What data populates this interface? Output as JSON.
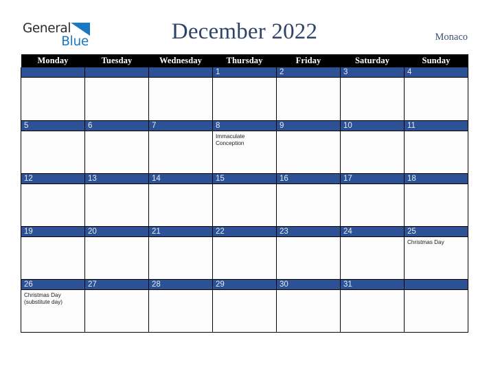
{
  "brand": {
    "name_part1": "General",
    "name_part2": "Blue",
    "triangle_icon": "blue-triangle-icon",
    "color_dark": "#2b2b2b",
    "color_blue": "#1878c4"
  },
  "header": {
    "title": "December 2022",
    "region": "Monaco",
    "title_color": "#2e4369"
  },
  "calendar": {
    "accent_color": "#2c5195",
    "header_bg": "#000000",
    "weekday_headers": [
      "Monday",
      "Tuesday",
      "Wednesday",
      "Thursday",
      "Friday",
      "Saturday",
      "Sunday"
    ],
    "weeks": [
      [
        {
          "day": "",
          "event": ""
        },
        {
          "day": "",
          "event": ""
        },
        {
          "day": "",
          "event": ""
        },
        {
          "day": "1",
          "event": ""
        },
        {
          "day": "2",
          "event": ""
        },
        {
          "day": "3",
          "event": ""
        },
        {
          "day": "4",
          "event": ""
        }
      ],
      [
        {
          "day": "5",
          "event": ""
        },
        {
          "day": "6",
          "event": ""
        },
        {
          "day": "7",
          "event": ""
        },
        {
          "day": "8",
          "event": "Immaculate\nConception"
        },
        {
          "day": "9",
          "event": ""
        },
        {
          "day": "10",
          "event": ""
        },
        {
          "day": "11",
          "event": ""
        }
      ],
      [
        {
          "day": "12",
          "event": ""
        },
        {
          "day": "13",
          "event": ""
        },
        {
          "day": "14",
          "event": ""
        },
        {
          "day": "15",
          "event": ""
        },
        {
          "day": "16",
          "event": ""
        },
        {
          "day": "17",
          "event": ""
        },
        {
          "day": "18",
          "event": ""
        }
      ],
      [
        {
          "day": "19",
          "event": ""
        },
        {
          "day": "20",
          "event": ""
        },
        {
          "day": "21",
          "event": ""
        },
        {
          "day": "22",
          "event": ""
        },
        {
          "day": "23",
          "event": ""
        },
        {
          "day": "24",
          "event": ""
        },
        {
          "day": "25",
          "event": "Christmas Day"
        }
      ],
      [
        {
          "day": "26",
          "event": "Christmas Day\n(substitute day)"
        },
        {
          "day": "27",
          "event": ""
        },
        {
          "day": "28",
          "event": ""
        },
        {
          "day": "29",
          "event": ""
        },
        {
          "day": "30",
          "event": ""
        },
        {
          "day": "31",
          "event": ""
        },
        {
          "day": "",
          "event": ""
        }
      ]
    ]
  }
}
